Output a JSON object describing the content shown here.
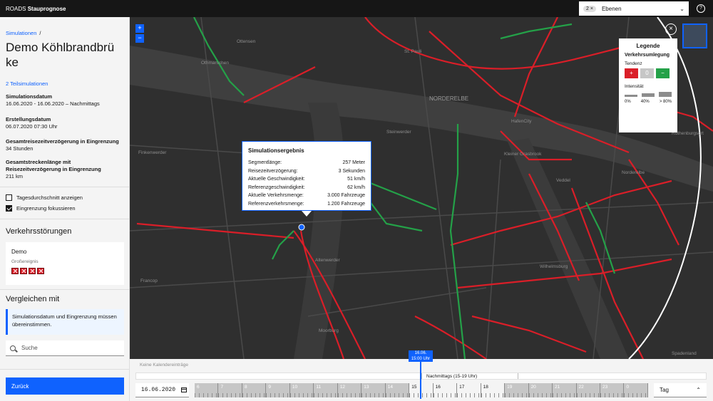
{
  "app": {
    "brand_prefix": "ROADS",
    "brand_name": "Stauprognose"
  },
  "layers": {
    "count": "2",
    "clear": "×",
    "label": "Ebenen",
    "help": "?"
  },
  "sidebar": {
    "breadcrumb": "Simulationen",
    "breadcrumb_sep": "/",
    "title": "Demo Köhlbrandbrü ke",
    "sub_link": "2 Teilsimulationen",
    "fields": [
      {
        "key": "Simulationsdatum",
        "value": "16.06.2020 - 16.06.2020 – Nachmittags"
      },
      {
        "key": "Erstellungsdatum",
        "value": "06.07.2020 07:30 Uhr"
      },
      {
        "key": "Gesamtreisezeitverzögerung in Eingrenzung",
        "value": "34 Stunden"
      },
      {
        "key": "Gesamtstreckenlänge mit Reisezeitverzögerung in Eingrenzung",
        "value": "211 km"
      }
    ],
    "checkbox_daily": "Tagesdurchschnitt anzeigen",
    "checkbox_focus": "Eingrenzung fokussieren",
    "section_disruptions": "Verkehrsstörungen",
    "disruption": {
      "name": "Demo",
      "type": "Großereignis"
    },
    "section_compare": "Vergleichen mit",
    "notice": "Simulationsdatum und Eingrenzung müssen übereinstimmen.",
    "search_placeholder": "Suche",
    "back_button": "Zurück"
  },
  "map": {
    "zoom_in": "+",
    "zoom_out": "−",
    "close": "×",
    "labels": [
      "St. Pauli",
      "Ottensen",
      "Othmarschen",
      "NORDERELBE",
      "Steinwerder",
      "HafenCity",
      "Kleiner Grasbrook",
      "Veddel",
      "Wilhelmsburg",
      "Altenwerder",
      "Francop",
      "Finkenwerder",
      "Moorburg",
      "Rothenburgsort",
      "Norderelbe",
      "Spadenland"
    ]
  },
  "legend": {
    "title": "Legende",
    "subtitle": "Verkehrsumlegung",
    "tendency_label": "Tendenz",
    "tendency_buttons": [
      "+",
      "0",
      "−"
    ],
    "intensity_label": "Intensität",
    "intensity_ticks": [
      "0%",
      "40%",
      "> 80%"
    ]
  },
  "popup": {
    "title": "Simulationsergebnis",
    "rows": [
      {
        "k": "Segmentlänge:",
        "v": "257 Meter"
      },
      {
        "k": "Reisezeitverzögerung:",
        "v": "3 Sekunden"
      },
      {
        "k": "Aktuelle Geschwindigkeit:",
        "v": "51 km/h"
      },
      {
        "k": "Referenzgeschwindigkeit:",
        "v": "62 km/h"
      },
      {
        "k": "Aktuelle Verkehrsmenge:",
        "v": "3.000 Fahrzeuge"
      },
      {
        "k": "Referenzverkehrsmenge:",
        "v": "1.200 Fahrzeuge"
      }
    ]
  },
  "timeline": {
    "calendar_note": "Keine Kalendereinträge",
    "period_label": "Nachmittags (15-19 Uhr)",
    "date": "16.06.2020",
    "needle_date": "16.06.",
    "needle_time": "15:00 Uhr",
    "hours": [
      "6",
      "7",
      "8",
      "9",
      "10",
      "11",
      "12",
      "13",
      "14",
      "15",
      "16",
      "17",
      "18",
      "19",
      "20",
      "21",
      "22",
      "23",
      "0"
    ],
    "selected_hours": [
      "15",
      "16",
      "17",
      "18"
    ],
    "granularity": "Tag"
  },
  "colors": {
    "accent": "#0f62fe",
    "increase": "#da1e28",
    "decrease": "#24a148",
    "neutral": "#8d8d8d"
  }
}
